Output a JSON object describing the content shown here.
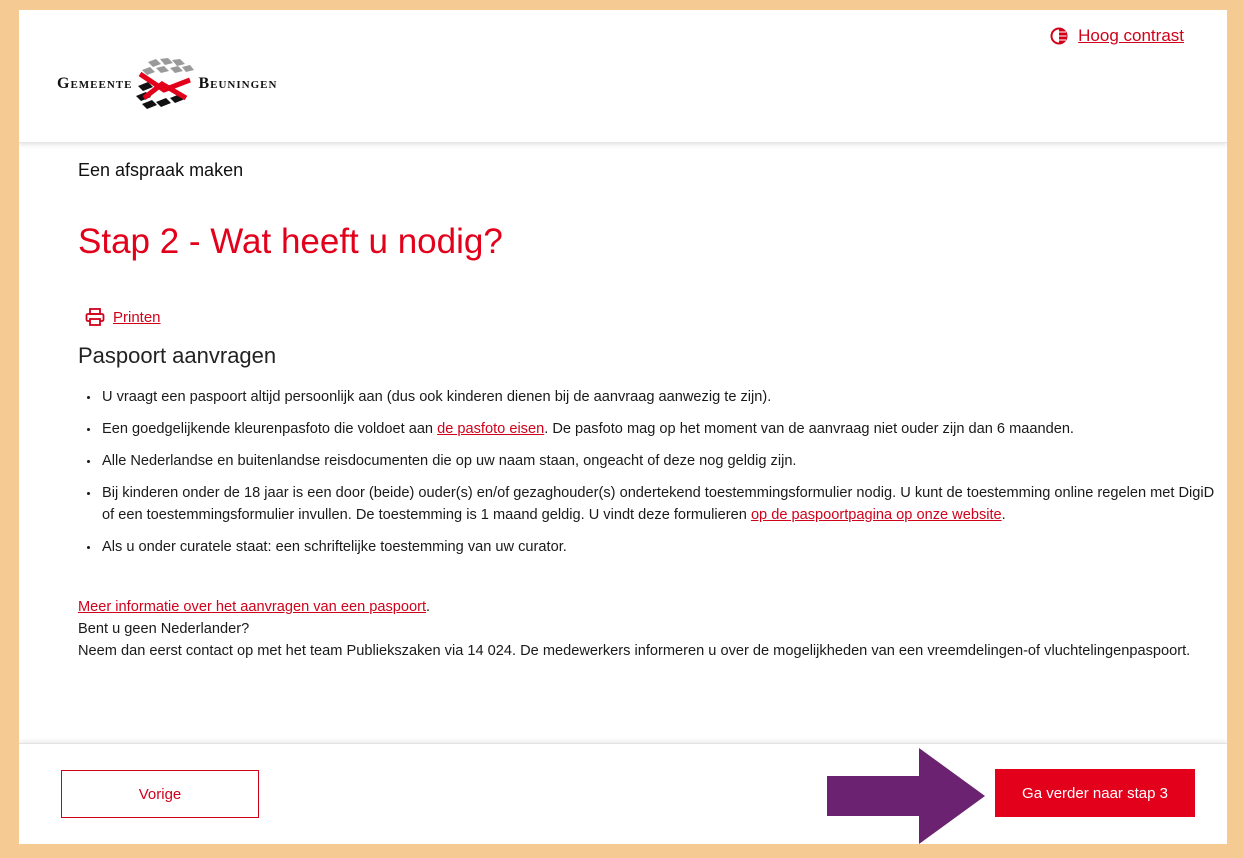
{
  "header": {
    "contrast_label": "Hoog contrast",
    "logo": {
      "word1": "Gemeente",
      "word2": "Beuningen"
    }
  },
  "main": {
    "section_title": "Een afspraak maken",
    "page_title": "Stap 2 - Wat heeft u nodig?",
    "print_label": "Printen",
    "subtitle": "Paspoort aanvragen",
    "items": [
      {
        "text": "U vraagt een paspoort altijd persoonlijk aan (dus ook kinderen dienen bij de aanvraag aanwezig te zijn)."
      },
      {
        "before": "Een goedgelijkende kleurenpasfoto die voldoet aan ",
        "link": "de pasfoto eisen",
        "after": ". De pasfoto mag op het moment van de aanvraag niet ouder zijn dan 6 maanden."
      },
      {
        "text": "Alle Nederlandse en buitenlandse reisdocumenten die op uw naam staan, ongeacht of deze nog geldig zijn."
      },
      {
        "before": "Bij kinderen onder de 18 jaar is een door (beide) ouder(s) en/of gezaghouder(s) ondertekend toestemmingsformulier nodig. U kunt de toestemming online regelen met DigiD of een toestemmingsformulier invullen. De toestemming is 1 maand geldig. U vindt deze formulieren ",
        "link": "op de paspoortpagina op onze website",
        "after": "."
      },
      {
        "text": "Als u onder curatele staat: een schriftelijke toestemming van uw curator."
      }
    ],
    "more_info_link": "Meer informatie over het aanvragen van een paspoort",
    "more_info_after": ".",
    "question": "Bent u geen Nederlander?",
    "contact_text": "Neem dan eerst contact op met het team Publiekszaken via 14 024. De medewerkers informeren u over de mogelijkheden van een vreemdelingen-of vluchtelingenpaspoort."
  },
  "footer": {
    "prev_label": "Vorige",
    "next_label": "Ga verder naar stap 3"
  },
  "colors": {
    "accent": "#e3001b",
    "link": "#d0021b",
    "frame": "#f5cb93",
    "annotation_arrow": "#6b2270"
  }
}
